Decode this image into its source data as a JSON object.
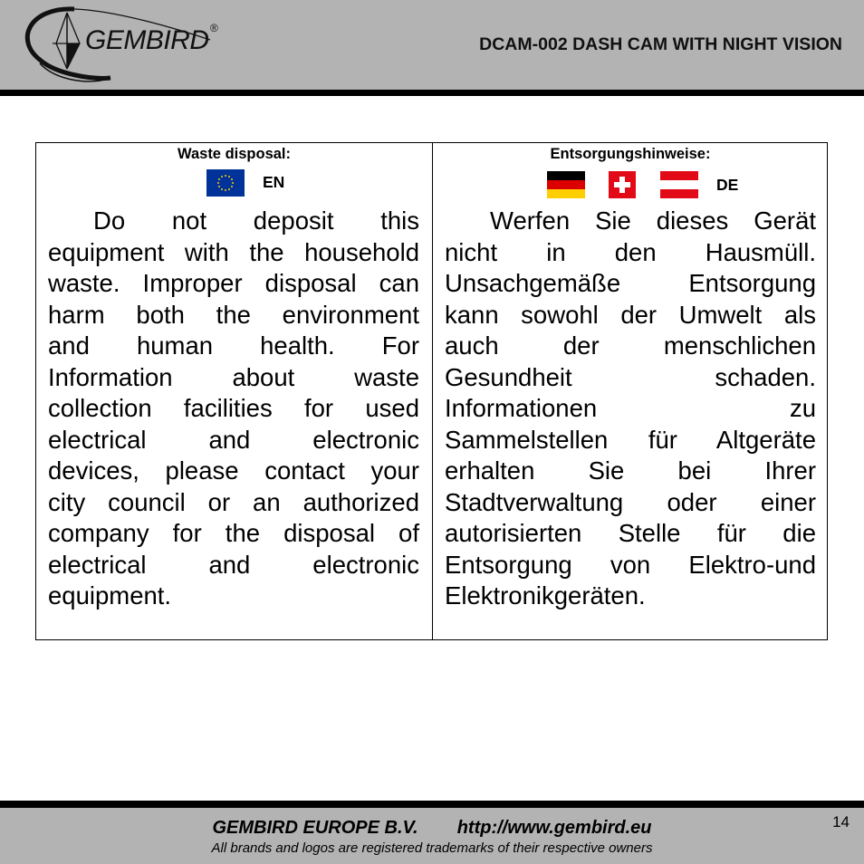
{
  "header": {
    "brand": "GEMBIRD",
    "registered_mark": "®",
    "document_title": "DCAM-002 DASH CAM WITH NIGHT VISION",
    "logo_icon": "gembird-logo-icon"
  },
  "content": {
    "columns": [
      {
        "title": "Waste disposal:",
        "language_code": "EN",
        "flags": [
          "eu-flag-icon"
        ],
        "lines": [
          "Do not deposit this",
          "equipment with the household",
          "waste. Improper disposal can",
          "harm both the environment",
          "and human health. For",
          "Information about waste",
          "collection facilities for used",
          "electrical and electronic",
          "devices, please contact your",
          "city council or an authorized",
          "company for the disposal of",
          "electrical and electronic",
          "equipment."
        ]
      },
      {
        "title": "Entsorgungshinweise:",
        "language_code": "DE",
        "flags": [
          "germany-flag-icon",
          "switzerland-flag-icon",
          "austria-flag-icon"
        ],
        "lines": [
          "Werfen Sie dieses Gerät",
          "nicht in den Hausmüll.",
          "Unsachgemäße Entsorgung",
          "kann sowohl der Umwelt als",
          "auch der menschlichen",
          "Gesundheit schaden.",
          "Informationen zu",
          "Sammelstellen für Altgeräte",
          "erhalten Sie bei Ihrer",
          "Stadtverwaltung oder einer",
          "autorisierten Stelle für die",
          "Entsorgung von Elektro-und",
          "Elektronikgeräten."
        ]
      }
    ]
  },
  "footer": {
    "company": "GEMBIRD EUROPE B.V.",
    "url": "http://www.gembird.eu",
    "trademark_note": "All brands and logos are registered trademarks of their respective owners",
    "page_number": "14"
  },
  "colors": {
    "band_gray": "#b3b3b3",
    "rule_black": "#000000",
    "eu_blue": "#003399",
    "eu_star": "#ffcc00",
    "de_black": "#000000",
    "de_red": "#dd0000",
    "de_gold": "#ffce00",
    "red": "#e30a17"
  }
}
